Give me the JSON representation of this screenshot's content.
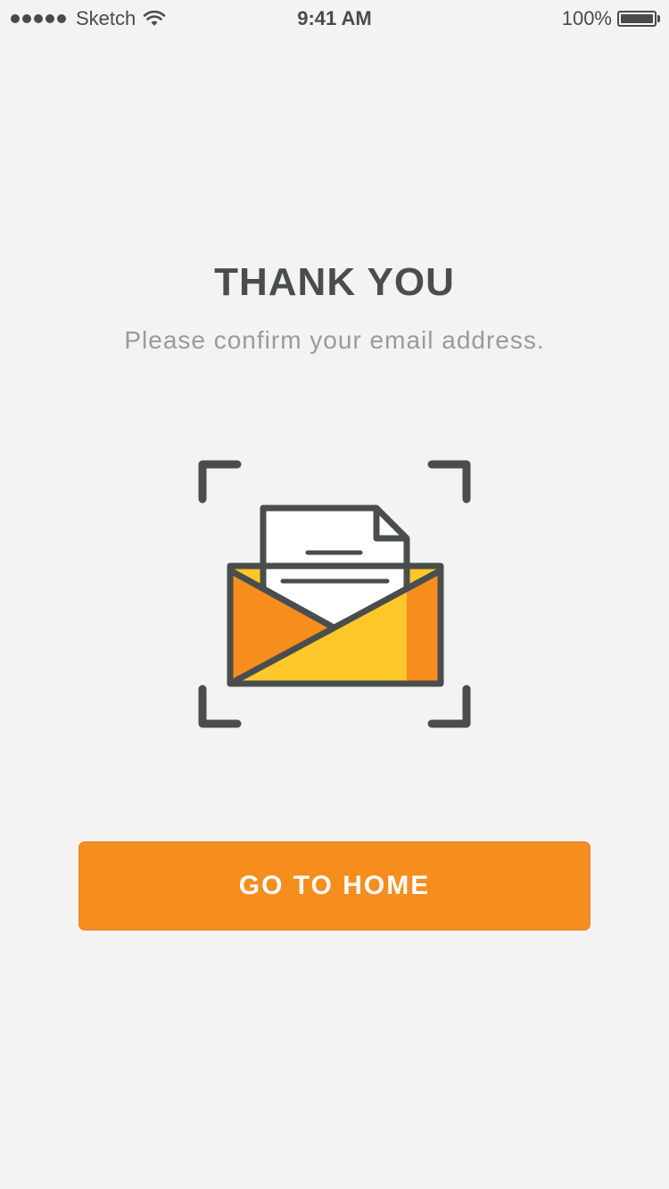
{
  "status_bar": {
    "carrier": "Sketch",
    "time": "9:41 AM",
    "battery": "100%"
  },
  "content": {
    "title": "THANK YOU",
    "subtitle": "Please confirm your email address."
  },
  "illustration": {
    "icon": "open-envelope-with-letter-icon",
    "colors": {
      "outline": "#4a4d4e",
      "envelope_yellow": "#ffc629",
      "envelope_orange": "#f68d1f",
      "paper": "#ffffff"
    }
  },
  "actions": {
    "home_button_label": "GO TO HOME",
    "accent_color": "#f68d1f"
  }
}
